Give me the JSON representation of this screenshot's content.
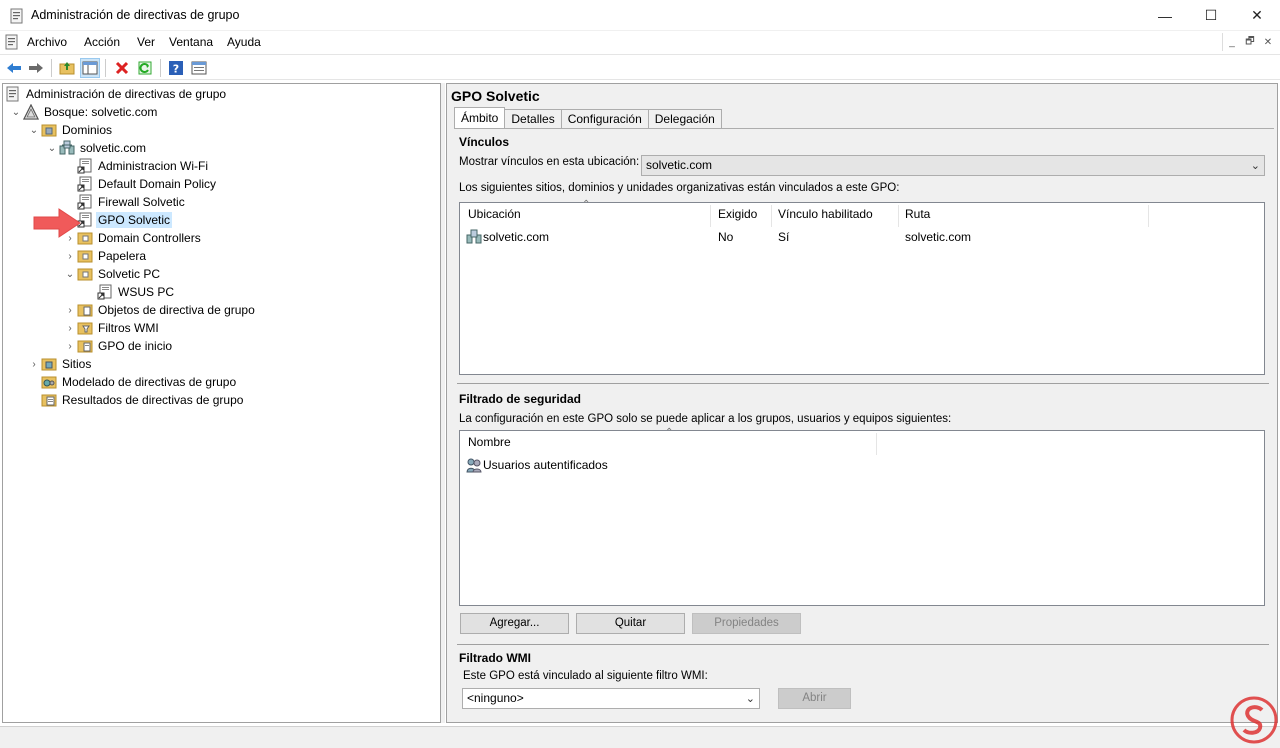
{
  "window": {
    "title": "Administración de directivas de grupo",
    "controls": {
      "minimize": "—",
      "maximize": "☐",
      "close": "✕"
    }
  },
  "menubar": {
    "items": [
      "Archivo",
      "Acción",
      "Ver",
      "Ventana",
      "Ayuda"
    ],
    "mdi_controls": [
      "_",
      "🗗",
      "✕"
    ]
  },
  "toolbar": {
    "buttons": [
      "back-icon",
      "forward-icon",
      "up-folder-icon",
      "show-hide-tree-icon",
      "delete-icon",
      "refresh-icon",
      "help-icon",
      "properties-icon"
    ]
  },
  "tree": {
    "root": "Administración de directivas de grupo",
    "forest": "Bosque: solvetic.com",
    "domains": "Dominios",
    "domain": "solvetic.com",
    "gpo_links": [
      "Administracion Wi-Fi",
      "Default Domain Policy",
      "Firewall Solvetic",
      "GPO Solvetic"
    ],
    "ous": [
      "Domain Controllers",
      "Papelera",
      "Solvetic PC"
    ],
    "ou_child": "WSUS PC",
    "containers": [
      "Objetos de directiva de grupo",
      "Filtros WMI",
      "GPO de inicio"
    ],
    "sites": "Sitios",
    "modeling": "Modelado de directivas de grupo",
    "results": "Resultados de directivas de grupo",
    "selected": "GPO Solvetic"
  },
  "details": {
    "title": "GPO Solvetic",
    "tabs": [
      "Ámbito",
      "Detalles",
      "Configuración",
      "Delegación"
    ],
    "active_tab": "Ámbito",
    "links": {
      "heading": "Vínculos",
      "show_links_label": "Mostrar vínculos en esta ubicación:",
      "show_links_value": "solvetic.com",
      "description": "Los siguientes sitios, dominios y unidades organizativas están vinculados a este GPO:",
      "columns": [
        "Ubicación",
        "Exigido",
        "Vínculo habilitado",
        "Ruta"
      ],
      "rows": [
        {
          "location": "solvetic.com",
          "enforced": "No",
          "enabled": "Sí",
          "path": "solvetic.com"
        }
      ]
    },
    "security": {
      "heading": "Filtrado de seguridad",
      "description": "La configuración en este GPO solo se puede aplicar a los grupos, usuarios y equipos siguientes:",
      "columns": [
        "Nombre"
      ],
      "rows": [
        "Usuarios autentificados"
      ],
      "buttons": {
        "add": "Agregar...",
        "remove": "Quitar",
        "properties": "Propiedades"
      }
    },
    "wmi": {
      "heading": "Filtrado WMI",
      "description": "Este GPO está vinculado al siguiente filtro WMI:",
      "value": "<ninguno>",
      "open_button": "Abrir"
    }
  },
  "colors": {
    "selection": "#cce8ff",
    "toolbar_pressed": "#cce4f7",
    "panel_bg": "#f0f0f0",
    "annotation_arrow": "#f05a5a",
    "watermark": "#d33"
  }
}
